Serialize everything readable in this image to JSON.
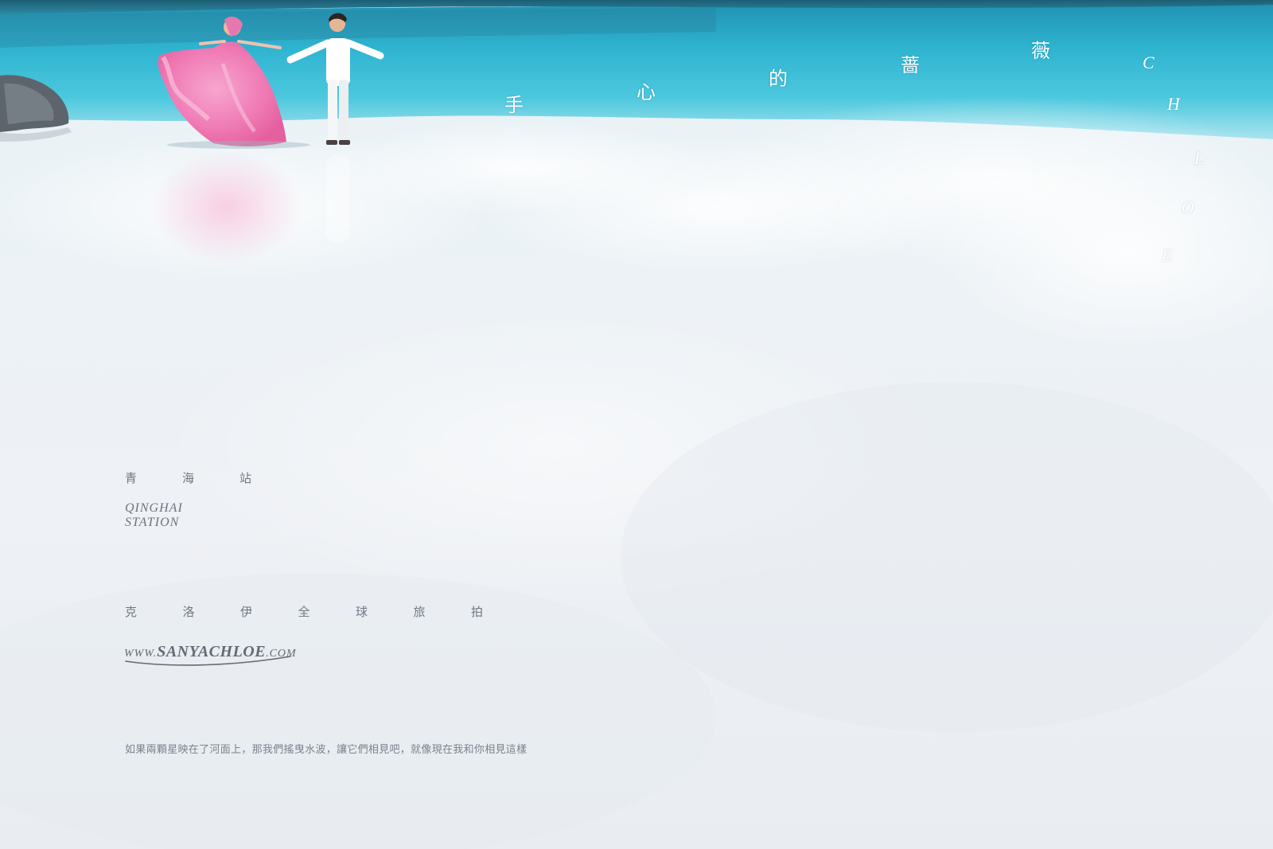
{
  "title": {
    "characters": [
      "手",
      "心",
      "的",
      "蔷",
      "薇"
    ]
  },
  "brand": {
    "letters": [
      "C",
      "H",
      "L",
      "O",
      "E"
    ]
  },
  "station": {
    "zh": [
      "青",
      "海",
      "站"
    ],
    "en_line1": "QINGHAI",
    "en_line2": "STATION"
  },
  "tagline": [
    "克",
    "洛",
    "伊",
    "全",
    "球",
    "旅",
    "拍"
  ],
  "website": {
    "prefix": "WWW.",
    "name": "SANYACHLOE",
    "suffix": ".COM"
  },
  "quote": "如果兩顆星映在了河面上，那我們搖曳水波，讓它們相見吧，就像現在我和你相見這樣",
  "colors": {
    "lake": "#2fb4d0",
    "salt_flat": "#eef1f4",
    "gown": "#f07cb6",
    "suit": "#ffffff",
    "caption_text": "#6f7782"
  }
}
